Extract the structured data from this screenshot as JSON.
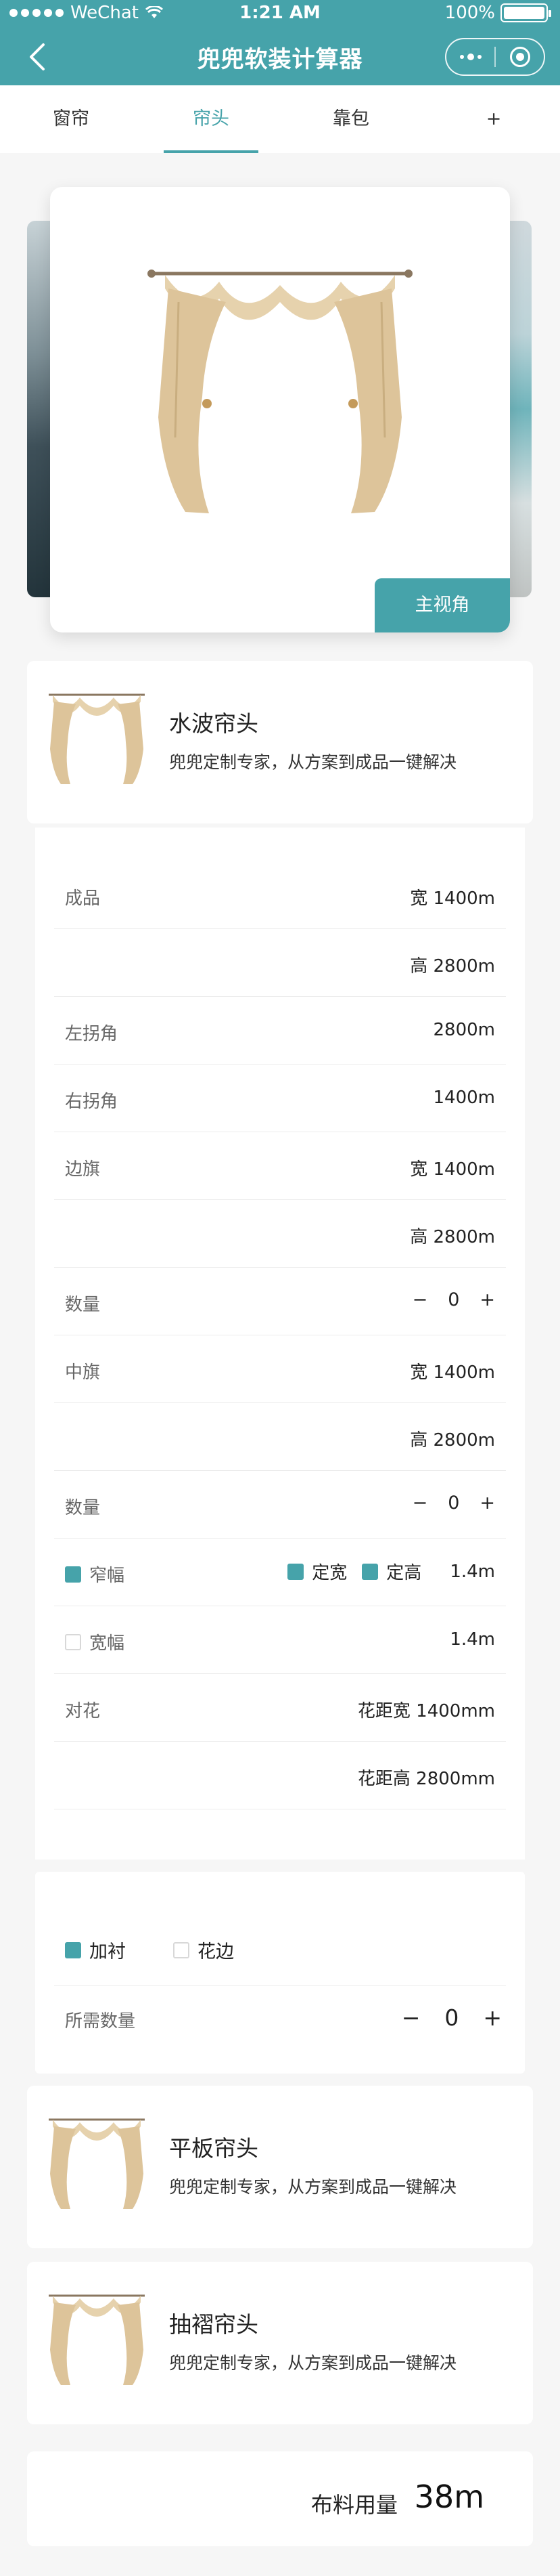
{
  "status_bar": {
    "carrier": "WeChat",
    "time": "1:21 AM",
    "battery": "100%"
  },
  "nav": {
    "title": "兜兜软装计算器"
  },
  "tabs": [
    {
      "label": "窗帘"
    },
    {
      "label": "帘头"
    },
    {
      "label": "靠包"
    },
    {
      "label": "+"
    }
  ],
  "active_tab": "帘头",
  "carousel": {
    "badge": "主视角"
  },
  "products": [
    {
      "name": "水波帘头",
      "desc": "兜兜定制专家，从方案到成品一键解决"
    },
    {
      "name": "平板帘头",
      "desc": "兜兜定制专家，从方案到成品一键解决"
    },
    {
      "name": "抽褶帘头",
      "desc": "兜兜定制专家，从方案到成品一键解决"
    }
  ],
  "spec": {
    "finished_label": "成品",
    "finished_width": "宽 1400m",
    "finished_height": "高 2800m",
    "left_corner_label": "左拐角",
    "left_corner_value": "2800m",
    "right_corner_label": "右拐角",
    "right_corner_value": "1400m",
    "side_flag_label": "边旗",
    "side_flag_width": "宽 1400m",
    "side_flag_height": "高 2800m",
    "qty_label": "数量",
    "side_flag_qty": "0",
    "center_flag_label": "中旗",
    "center_flag_width": "宽 1400m",
    "center_flag_height": "高 2800m",
    "center_flag_qty": "0",
    "minus": "−",
    "plus": "+",
    "narrow_label": "窄幅",
    "fixed_width_label": "定宽",
    "fixed_height_label": "定高",
    "narrow_value": "1.4m",
    "wide_label": "宽幅",
    "wide_value": "1.4m",
    "pattern_label": "对花",
    "pattern_width": "花距宽 1400mm",
    "pattern_height": "花距高 2800mm"
  },
  "lining": {
    "lining_label": "加衬",
    "lining_checked": true,
    "trim_label": "花边",
    "trim_checked": false,
    "qty_label": "所需数量",
    "qty": "0",
    "minus": "−",
    "plus": "+"
  },
  "total": {
    "label": "布料用量",
    "value": "38m"
  },
  "colors": {
    "accent": "#46a3aa",
    "background": "#f6f6f6"
  }
}
